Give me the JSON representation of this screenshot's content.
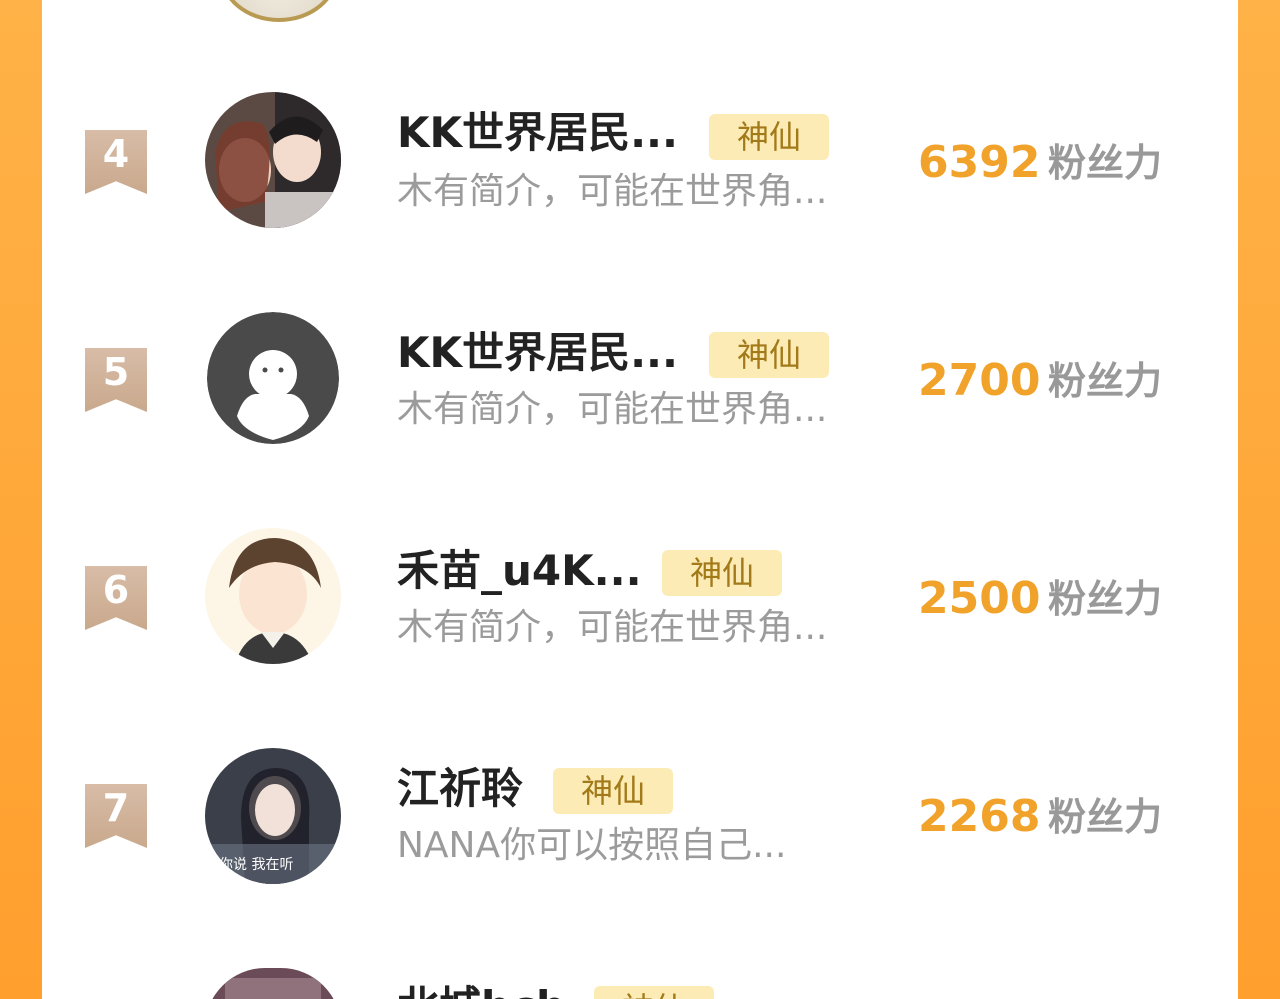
{
  "rows": [
    {
      "rank": "4",
      "name": "KK世界居民...",
      "badge": "神仙",
      "bio": "木有简介，可能在世界角...",
      "score": "6392",
      "score_label": "粉丝力"
    },
    {
      "rank": "5",
      "name": "KK世界居民...",
      "badge": "神仙",
      "bio": "木有简介，可能在世界角...",
      "score": "2700",
      "score_label": "粉丝力"
    },
    {
      "rank": "6",
      "name": "禾苗_u4K...",
      "badge": "神仙",
      "bio": "木有简介，可能在世界角...",
      "score": "2500",
      "score_label": "粉丝力"
    },
    {
      "rank": "7",
      "name": "江祈聆",
      "badge": "神仙",
      "bio": "NANA你可以按照自己...",
      "score": "2268",
      "score_label": "粉丝力",
      "avatar_caption": "你说 我在听"
    },
    {
      "name": "北城bcb",
      "badge": "神仙"
    }
  ],
  "colors": {
    "accent_orange": "#f0a22b",
    "frame_orange": "#ffa93a",
    "badge_bg": "#fcebb4",
    "rank_ribbon": "#cfb097"
  }
}
